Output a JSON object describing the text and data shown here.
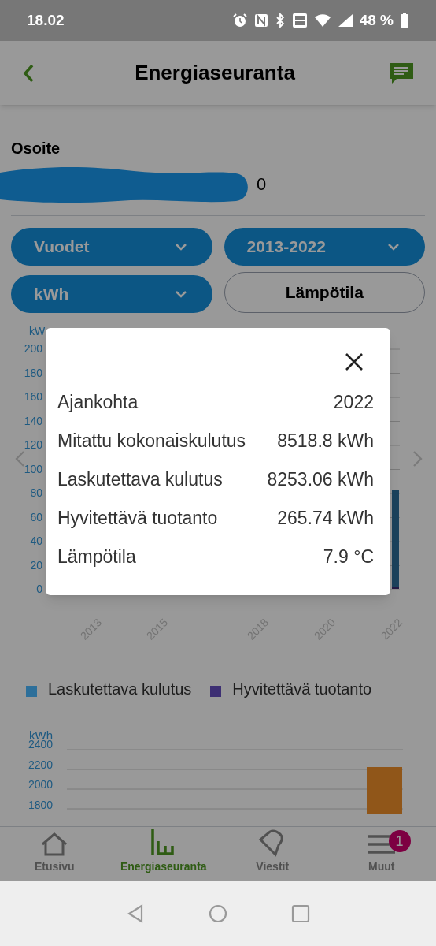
{
  "status_bar": {
    "time": "18.02",
    "battery": "48 %"
  },
  "header": {
    "title": "Energiaseuranta"
  },
  "address": {
    "label": "Osoite",
    "visible_value": "0"
  },
  "filters": [
    {
      "kind": "dropdown",
      "label": "Vuodet"
    },
    {
      "kind": "dropdown",
      "label": "2013-2022"
    },
    {
      "kind": "dropdown",
      "label": "kWh"
    },
    {
      "kind": "button",
      "label": "Lämpötila"
    }
  ],
  "chart_1": {
    "y_unit": "kW",
    "y_ticks": [
      "200",
      "180",
      "160",
      "140",
      "120",
      "100",
      "80",
      "60",
      "40",
      "20",
      "0"
    ],
    "x_labels": [
      "2013",
      "2015",
      "2018",
      "2020",
      "2022"
    ],
    "legend": [
      {
        "label": "Laskutettava kulutus",
        "color": "#2d6f9a"
      },
      {
        "label": "Hyvitettävä tuotanto",
        "color": "#3d2f73"
      }
    ]
  },
  "chart_2": {
    "y_unit": "kWh",
    "y_ticks": [
      "2400",
      "2200",
      "2000",
      "1800"
    ]
  },
  "dialog": {
    "rows": [
      {
        "label": "Ajankohta",
        "value": "2022"
      },
      {
        "label": "Mitattu kokonaiskulutus",
        "value": "8518.8 kWh"
      },
      {
        "label": "Laskutettava kulutus",
        "value": "8253.06 kWh"
      },
      {
        "label": "Hyvitettävä tuotanto",
        "value": "265.74 kWh"
      },
      {
        "label": "Lämpötila",
        "value": "7.9 °C"
      }
    ]
  },
  "bottom_nav": [
    {
      "label": "Etusivu",
      "selected": false
    },
    {
      "label": "Energiaseuranta",
      "selected": true
    },
    {
      "label": "Viestit",
      "selected": false
    },
    {
      "label": "Muut",
      "selected": false,
      "badge": "1"
    }
  ]
}
